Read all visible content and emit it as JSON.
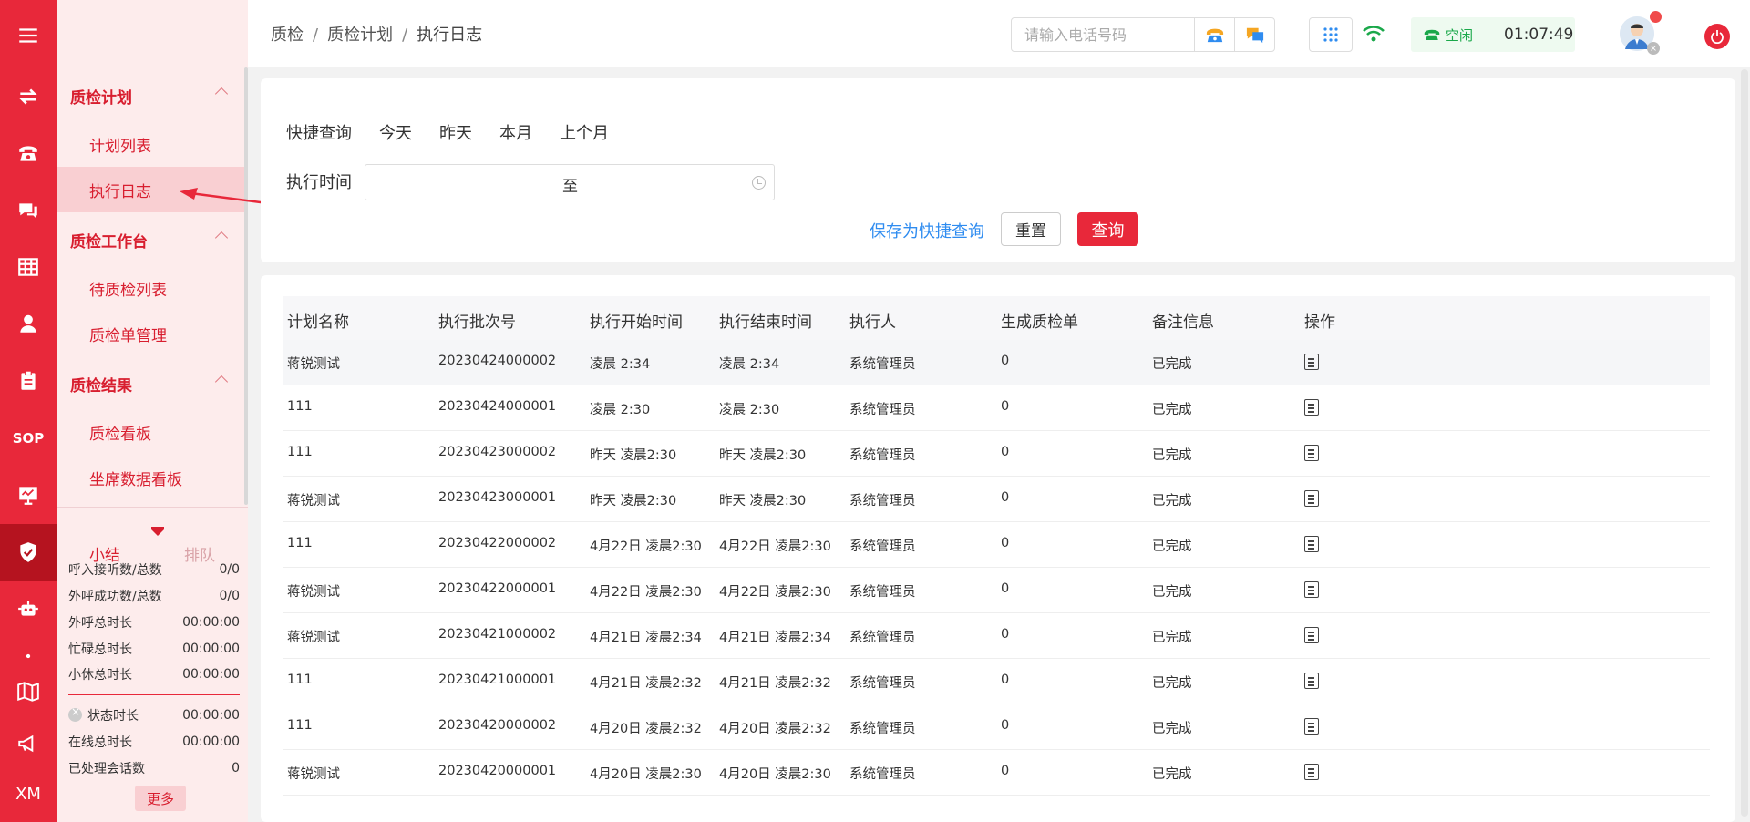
{
  "rail": {
    "items": [
      {
        "name": "menu-icon"
      },
      {
        "name": "transfer-icon"
      },
      {
        "name": "phone-icon"
      },
      {
        "name": "chat-icon"
      },
      {
        "name": "grid-icon"
      },
      {
        "name": "user-icon"
      },
      {
        "name": "clipboard-icon"
      },
      {
        "name": "sop-icon",
        "label": "SOP"
      },
      {
        "name": "monitor-icon"
      },
      {
        "name": "shield-icon"
      },
      {
        "name": "robot-icon"
      },
      {
        "name": "dot-icon"
      },
      {
        "name": "book-icon"
      },
      {
        "name": "megaphone-icon"
      },
      {
        "name": "xm-icon",
        "label": "XM"
      }
    ]
  },
  "sidebar": {
    "groups": [
      {
        "label": "质检计划",
        "items": [
          "计划列表",
          "执行日志"
        ]
      },
      {
        "label": "质检工作台",
        "items": [
          "待质检列表",
          "质检单管理"
        ]
      },
      {
        "label": "质检结果",
        "items": [
          "质检看板",
          "坐席数据看板"
        ]
      }
    ],
    "active_item": "执行日志"
  },
  "summary": {
    "tab_active": "小结",
    "tab_other": "排队",
    "rows": [
      {
        "label": "呼入接听数/总数",
        "value": "0/0"
      },
      {
        "label": "外呼成功数/总数",
        "value": "0/0"
      },
      {
        "label": "外呼总时长",
        "value": "00:00:00"
      },
      {
        "label": "忙碌总时长",
        "value": "00:00:00"
      },
      {
        "label": "小休总时长",
        "value": "00:00:00"
      }
    ],
    "rows2": [
      {
        "label": "状态时长",
        "value": "00:00:00"
      },
      {
        "label": "在线总时长",
        "value": "00:00:00"
      },
      {
        "label": "已处理会话数",
        "value": "0"
      }
    ],
    "more": "更多"
  },
  "topbar": {
    "breadcrumb": [
      "质检",
      "质检计划",
      "执行日志"
    ],
    "phone_placeholder": "请输入电话号码",
    "status": "空闲",
    "timer": "01:07:49"
  },
  "filter": {
    "quick_label": "快捷查询",
    "quick_options": [
      "今天",
      "昨天",
      "本月",
      "上个月"
    ],
    "time_label": "执行时间",
    "range_sep": "至",
    "save_link": "保存为快捷查询",
    "reset": "重置",
    "query": "查询"
  },
  "table": {
    "columns": [
      "计划名称",
      "执行批次号",
      "执行开始时间",
      "执行结束时间",
      "执行人",
      "生成质检单",
      "备注信息",
      "操作"
    ],
    "rows": [
      [
        "蒋锐测试",
        "20230424000002",
        "凌晨 2:34",
        "凌晨 2:34",
        "系统管理员",
        "0",
        "已完成"
      ],
      [
        "111",
        "20230424000001",
        "凌晨 2:30",
        "凌晨 2:30",
        "系统管理员",
        "0",
        "已完成"
      ],
      [
        "111",
        "20230423000002",
        "昨天 凌晨2:30",
        "昨天 凌晨2:30",
        "系统管理员",
        "0",
        "已完成"
      ],
      [
        "蒋锐测试",
        "20230423000001",
        "昨天 凌晨2:30",
        "昨天 凌晨2:30",
        "系统管理员",
        "0",
        "已完成"
      ],
      [
        "111",
        "20230422000002",
        "4月22日 凌晨2:30",
        "4月22日 凌晨2:30",
        "系统管理员",
        "0",
        "已完成"
      ],
      [
        "蒋锐测试",
        "20230422000001",
        "4月22日 凌晨2:30",
        "4月22日 凌晨2:30",
        "系统管理员",
        "0",
        "已完成"
      ],
      [
        "蒋锐测试",
        "20230421000002",
        "4月21日 凌晨2:34",
        "4月21日 凌晨2:34",
        "系统管理员",
        "0",
        "已完成"
      ],
      [
        "111",
        "20230421000001",
        "4月21日 凌晨2:32",
        "4月21日 凌晨2:32",
        "系统管理员",
        "0",
        "已完成"
      ],
      [
        "111",
        "20230420000002",
        "4月20日 凌晨2:32",
        "4月20日 凌晨2:32",
        "系统管理员",
        "0",
        "已完成"
      ],
      [
        "蒋锐测试",
        "20230420000001",
        "4月20日 凌晨2:30",
        "4月20日 凌晨2:30",
        "系统管理员",
        "0",
        "已完成"
      ]
    ],
    "op_icon": "document-icon"
  },
  "colors": {
    "brand": "#e8283a",
    "link": "#2f8cf0",
    "status_green": "#1aa84a"
  }
}
